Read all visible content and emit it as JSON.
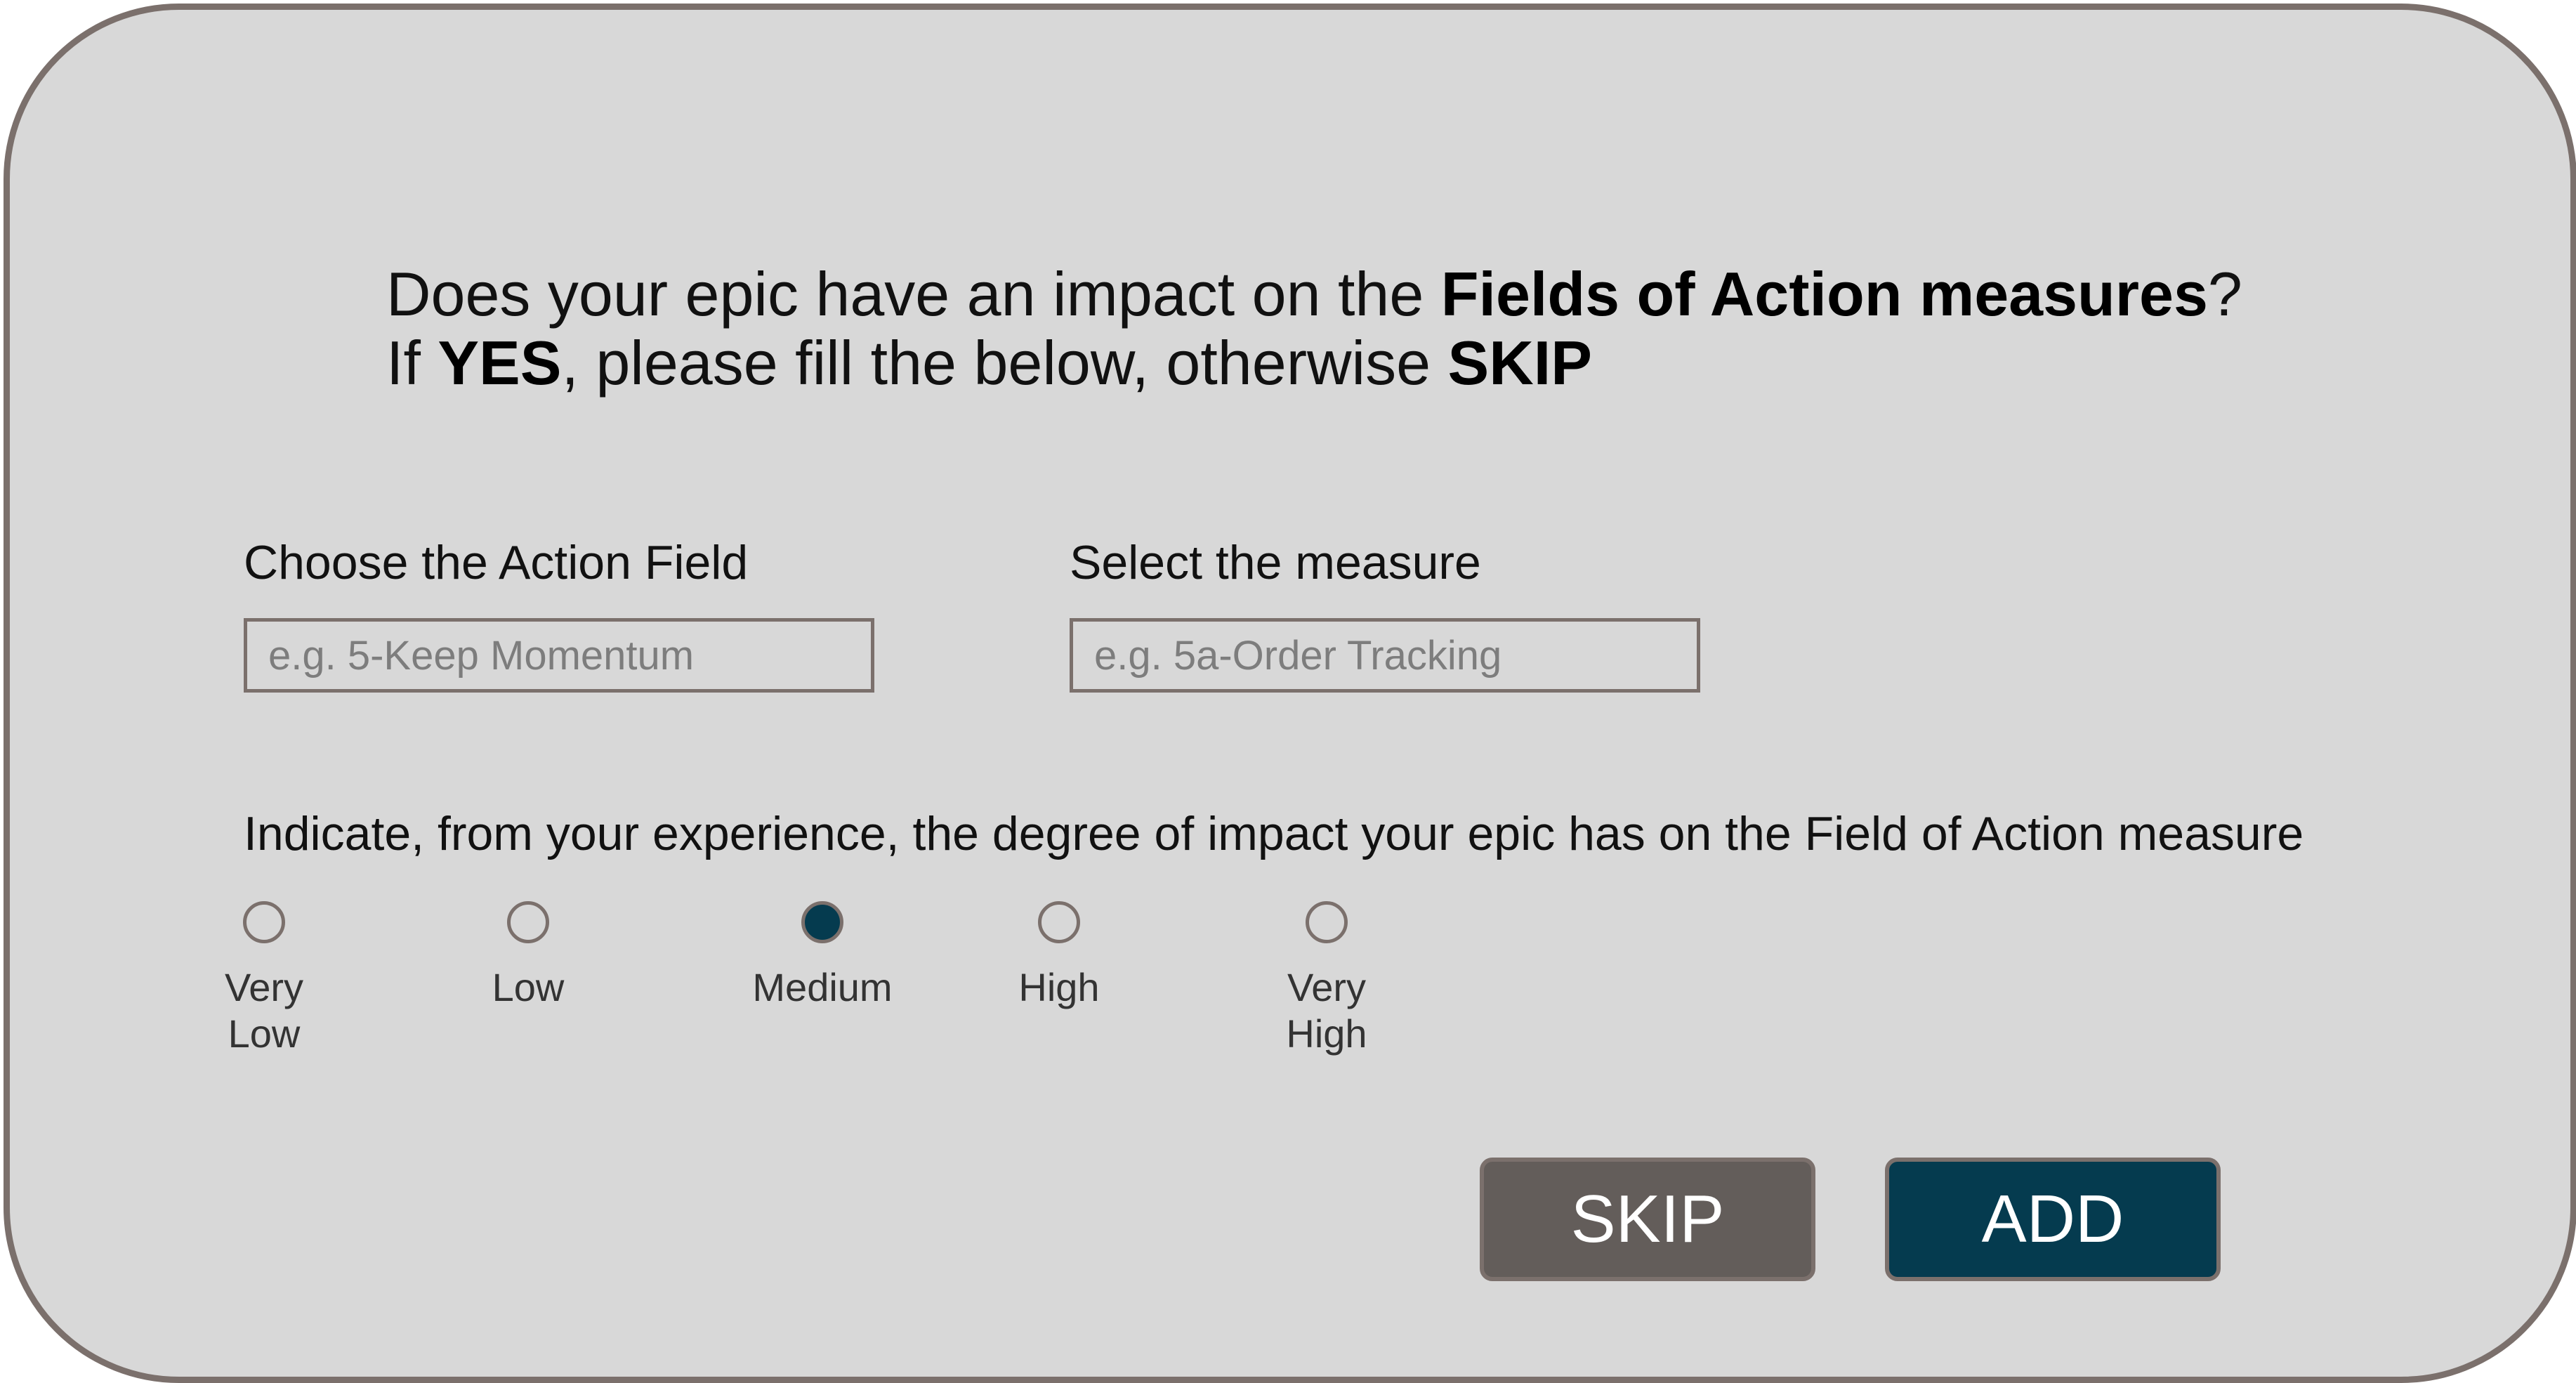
{
  "heading": {
    "line1_prefix": "Does your epic have an impact on the ",
    "line1_bold": "Fields of Action measures",
    "line1_suffix": "?",
    "line2_prefix": "If ",
    "line2_bold_yes": "YES",
    "line2_middle": ", please fill the below, otherwise ",
    "line2_bold_skip": "SKIP"
  },
  "action_field": {
    "label": "Choose the Action Field",
    "placeholder": "e.g. 5-Keep Momentum",
    "value": ""
  },
  "measure": {
    "label": "Select the measure",
    "placeholder": "e.g. 5a-Order Tracking",
    "value": ""
  },
  "impact": {
    "prompt": "Indicate, from your experience, the degree of impact your epic has on the Field of Action measure",
    "selected": "Medium",
    "options": [
      {
        "label": "Very\nLow"
      },
      {
        "label": "Low"
      },
      {
        "label": "Medium"
      },
      {
        "label": "High"
      },
      {
        "label": "Very\nHigh"
      }
    ]
  },
  "buttons": {
    "skip_label": "SKIP",
    "add_label": "ADD"
  },
  "colors": {
    "card_background": "#d8d8d8",
    "border": "#7b706c",
    "skip_button": "#635d5a",
    "add_button": "#053b4f",
    "radio_selected": "#053b4f"
  }
}
